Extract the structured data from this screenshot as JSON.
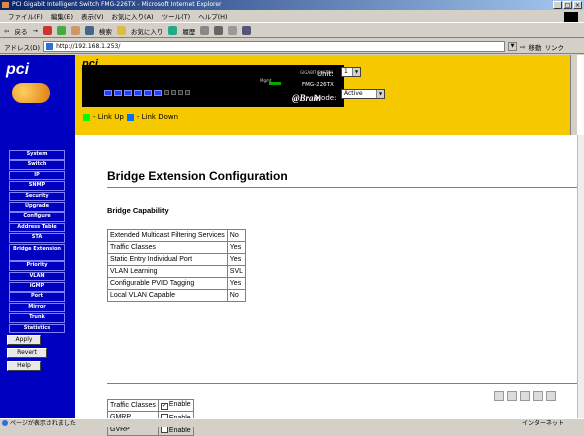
{
  "window": {
    "title": "PCI Gigabit Intelligent Switch FMG-226TX - Microsoft Internet Explorer"
  },
  "menubar": [
    "ファイル(F)",
    "編集(E)",
    "表示(V)",
    "お気に入り(A)",
    "ツール(T)",
    "ヘルプ(H)"
  ],
  "toolbar": {
    "back": "戻る",
    "search": "検索",
    "favorites": "お気に入り",
    "history": "履歴"
  },
  "address": {
    "label": "アドレス(D)",
    "url": "http://192.168.1.253/",
    "go": "移動",
    "links": "リンク"
  },
  "sidebar": {
    "logo": "pci",
    "nav": [
      "System",
      "Switch",
      "IP",
      "SNMP",
      "Security",
      "Upgrade",
      "Configure",
      "Address Table",
      "STA",
      "Bridge Extension",
      "Priority",
      "VLAN",
      "IGMP",
      "Port",
      "Mirror",
      "Trunk",
      "Statistics"
    ],
    "actions": [
      "Apply",
      "Revert",
      "Help"
    ]
  },
  "panel": {
    "logo": "pci",
    "device_top": "GIGABIT SWITCH",
    "mgmt": "Mgmt",
    "model": "FMG-226TX",
    "brain": "@Brain",
    "unit_label": "Unit:",
    "unit_value": "1",
    "mode_label": "Mode:",
    "mode_value": "Active",
    "legend_up": "- Link Up",
    "legend_down": "- Link Down",
    "colors": {
      "up": "#00ff00",
      "down": "#0070ff"
    }
  },
  "content": {
    "title": "Bridge Extension Configuration",
    "section": "Bridge Capability",
    "capabilities": [
      {
        "name": "Extended Multicast Filtering Services",
        "value": "No"
      },
      {
        "name": "Traffic Classes",
        "value": "Yes"
      },
      {
        "name": "Static Entry Individual Port",
        "value": "Yes"
      },
      {
        "name": "VLAN Learning",
        "value": "SVL"
      },
      {
        "name": "Configurable PVID Tagging",
        "value": "Yes"
      },
      {
        "name": "Local VLAN Capable",
        "value": "No"
      }
    ],
    "options": [
      {
        "name": "Traffic Classes",
        "checked": true,
        "label": "Enable"
      },
      {
        "name": "GMRP",
        "checked": false,
        "label": "Enable"
      },
      {
        "name": "GVRP",
        "checked": false,
        "label": "Enable"
      }
    ]
  },
  "statusbar": {
    "left": "ページが表示されました",
    "zone": "インターネット"
  }
}
